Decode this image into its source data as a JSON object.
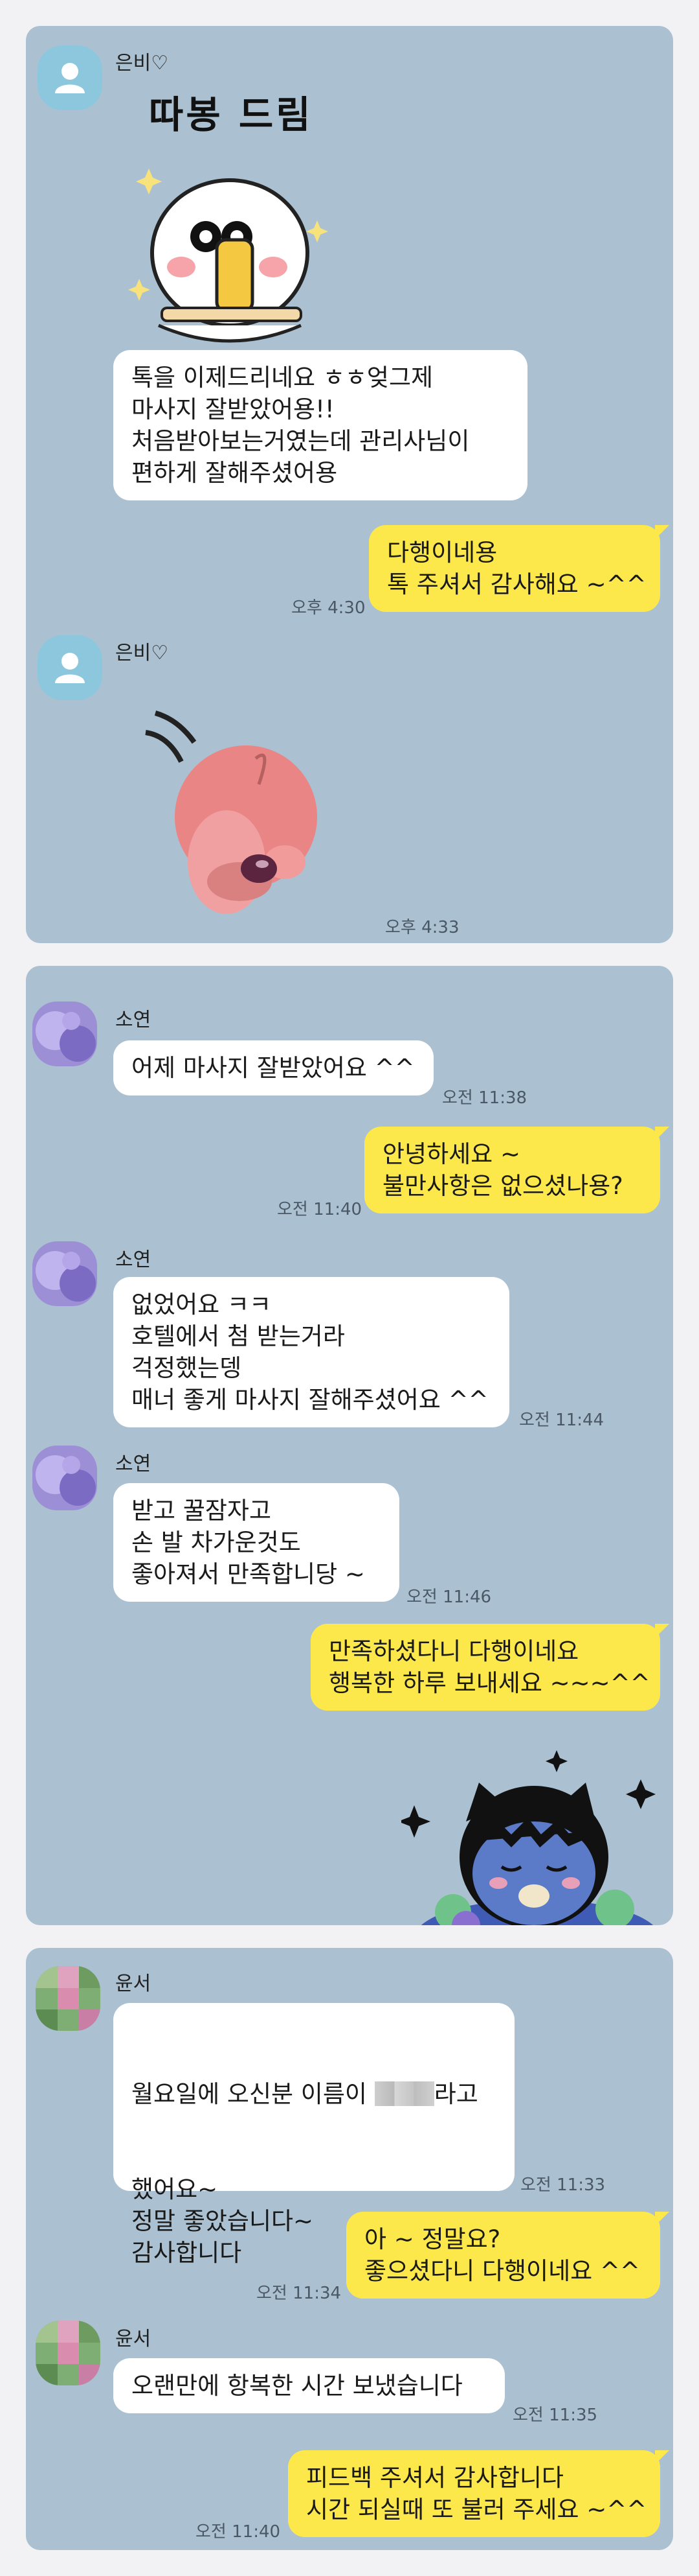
{
  "colors": {
    "chat_background": "#abc1d1",
    "page_background": "#f2f2f4",
    "outgoing_bubble": "#fde84c",
    "incoming_bubble": "#ffffff"
  },
  "chat1": {
    "sender_name": "은비♡",
    "sticker_caption": "따봉 드림",
    "msg1": "톡을 이제드리네요 ㅎㅎ엊그제\n마사지 잘받았어용!!\n처음받아보는거였는데 관리사님이\n편하게 잘해주셨어용",
    "reply1": "다행이네용\n톡 주셔서 감사해요 ~^^",
    "reply1_time": "오후 4:30",
    "sender_name_2": "은비♡",
    "sticker2_time": "오후 4:33"
  },
  "chat2": {
    "sender_name": "소연",
    "msg1": "어제 마사지 잘받았어요 ^^",
    "msg1_time": "오전 11:38",
    "reply1": "안녕하세요 ~\n불만사항은 없으셨나용?",
    "reply1_time": "오전 11:40",
    "sender_name_2": "소연",
    "msg2": "없었어요 ㅋㅋ\n호텔에서 첨 받는거라\n걱정했는뎅\n매너 좋게 마사지 잘해주셨어요 ^^",
    "msg2_time": "오전 11:44",
    "sender_name_3": "소연",
    "msg3": "받고 꿀잠자고\n손 발 차가운것도\n좋아져서 만족합니당 ~",
    "msg3_time": "오전 11:46",
    "reply2": "만족하셨다니 다행이네요\n행복한 하루 보내세요 ~~~^^"
  },
  "chat3": {
    "sender_name": "윤서",
    "msg1_part1": "월요일에 오신분 이름이 ",
    "msg1_part2": "라고",
    "msg1_rest": "했어요~\n정말 좋았습니다~\n감사합니다",
    "msg1_time": "오전 11:33",
    "reply1": "아 ~ 정말요?\n좋으셨다니 다행이네요 ^^",
    "reply1_time": "오전 11:34",
    "sender_name_2": "윤서",
    "msg2": "오랜만에 항복한 시간 보냈습니다",
    "msg2_time": "오전 11:35",
    "reply2": "피드백 주셔서 감사합니다\n시간 되실때 또 불러 주세요 ~^^",
    "reply2_time": "오전 11:40"
  }
}
